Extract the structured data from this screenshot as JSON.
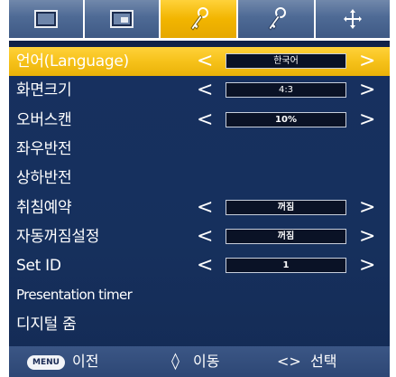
{
  "tabs": [
    {
      "icon": "picture-icon",
      "active": false
    },
    {
      "icon": "picture-in-picture-icon",
      "active": false
    },
    {
      "icon": "settings-key-icon",
      "active": true
    },
    {
      "icon": "options-key-icon",
      "active": false
    },
    {
      "icon": "input-arrows-icon",
      "active": false
    }
  ],
  "menu": {
    "items": [
      {
        "label": "언어(Language)",
        "value": "한국어",
        "has_value": true,
        "selected": true
      },
      {
        "label": "화면크기",
        "value": "4:3",
        "has_value": true,
        "selected": false
      },
      {
        "label": "오버스캔",
        "value": "10%",
        "has_value": true,
        "selected": false
      },
      {
        "label": "좌우반전",
        "value": "",
        "has_value": false,
        "selected": false
      },
      {
        "label": "상하반전",
        "value": "",
        "has_value": false,
        "selected": false
      },
      {
        "label": "취침예약",
        "value": "꺼짐",
        "has_value": true,
        "selected": false
      },
      {
        "label": "자동꺼짐설정",
        "value": "꺼짐",
        "has_value": true,
        "selected": false
      },
      {
        "label": "Set ID",
        "value": "1",
        "has_value": true,
        "selected": false
      },
      {
        "label": "Presentation timer",
        "value": "",
        "has_value": false,
        "selected": false
      },
      {
        "label": "디지털 줌",
        "value": "",
        "has_value": false,
        "selected": false
      }
    ],
    "arrow_left": "<",
    "arrow_right": ">"
  },
  "footer": {
    "menu_key": "MENU",
    "back_label": "이전",
    "move_symbol": "◊",
    "move_label": "이동",
    "select_symbol": "<>",
    "select_label": "선택"
  },
  "colors": {
    "panel": "#16305d",
    "selected_row": "#f6c21a",
    "tab_inactive": "#4e6a95",
    "tab_active": "#f2b500"
  }
}
